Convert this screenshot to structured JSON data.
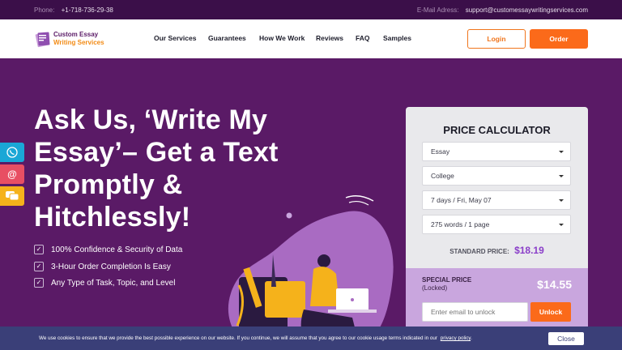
{
  "topbar": {
    "phone_label": "Phone:",
    "phone": "+1-718-736-29-38",
    "email_label": "E-Mail Adress:",
    "email": "support@customessaywritingservices.com"
  },
  "header": {
    "logo_line1": "Custom Essay",
    "logo_line2": "Writing Services",
    "nav": [
      "Our Services",
      "Guarantees",
      "How We Work",
      "Reviews",
      "FAQ",
      "Samples"
    ],
    "login_label": "Login",
    "order_label": "Order"
  },
  "hero": {
    "headline_lines": [
      "Ask Us, ‘Write My",
      "Essay’– Get a Text",
      "Promptly &",
      "Hitchlessly!"
    ],
    "features": [
      "100% Confidence & Security of Data",
      "3-Hour Order Completion Is Easy",
      "Any Type of Task, Topic, and Level"
    ]
  },
  "social": [
    {
      "icon": "whatsapp-icon",
      "color": "#1aa7d6"
    },
    {
      "icon": "email-icon",
      "color": "#e84f63"
    },
    {
      "icon": "chat-icon",
      "color": "#f5b21b"
    }
  ],
  "calculator": {
    "title": "PRICE CALCULATOR",
    "paper_type": "Essay",
    "level": "College",
    "deadline": "7 days / Fri, May 07",
    "pages": "275 words / 1 page",
    "standard_label": "STANDARD PRICE:",
    "standard_price": "$18.19",
    "special_label": "SPECIAL PRICE",
    "special_sub": "(Locked)",
    "special_price": "$14.55",
    "email_placeholder": "Enter email to unlock",
    "unlock_label": "Unlock"
  },
  "cookie": {
    "message": "We use cookies to ensure that we provide the best possible experience on our website. If you continue, we will assume that you agree to our cookie usage terms indicated in our",
    "policy_link": "privacy policy",
    "close_label": "Close"
  },
  "colors": {
    "brand_purple": "#5a1a66",
    "accent_orange": "#fb6a1a",
    "special_bg": "#c9a6de",
    "std_price": "#8a3ec9"
  }
}
